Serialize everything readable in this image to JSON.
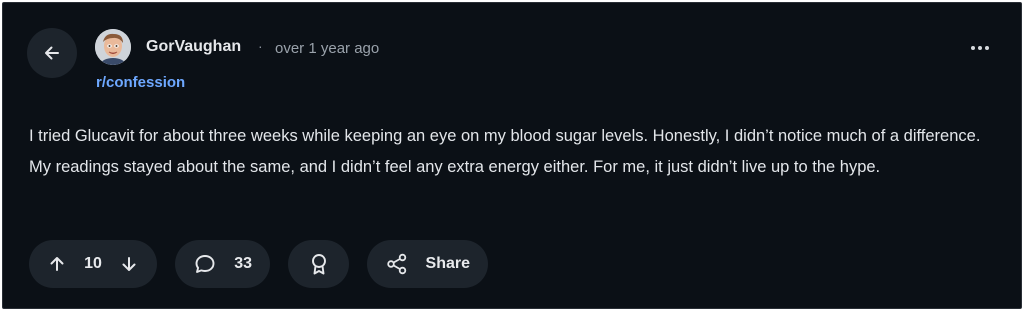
{
  "post": {
    "author": "GorVaughan",
    "separator": "·",
    "time": "over 1 year ago",
    "subreddit": "r/confession",
    "body": "I tried Glucavit for about three weeks while keeping an eye on my blood sugar levels. Honestly, I didn’t notice much of a difference. My readings stayed about the same, and I didn’t feel any extra energy either. For me, it just didn’t live up to the hype."
  },
  "actions": {
    "vote_count": "10",
    "comment_count": "33",
    "share_label": "Share"
  },
  "icons": {
    "back": "arrow-left-icon",
    "more": "more-horizontal-icon",
    "upvote": "arrow-up-icon",
    "downvote": "arrow-down-icon",
    "comment": "speech-bubble-icon",
    "award": "award-ribbon-icon",
    "share": "share-nodes-icon"
  },
  "colors": {
    "background": "#0b1016",
    "pill": "#1d242c",
    "link": "#6ea8ff",
    "text": "#e3e6ea"
  }
}
